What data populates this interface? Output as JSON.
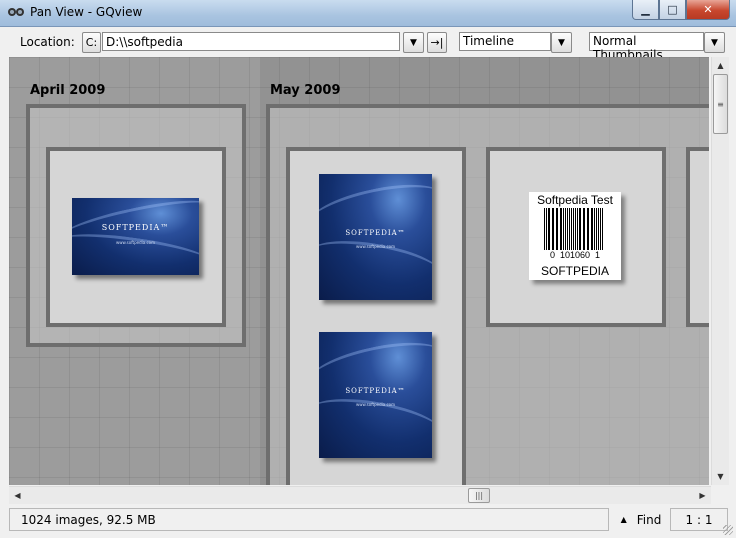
{
  "window": {
    "title": "Pan View - GQview",
    "controls": {
      "minimize": "▁",
      "maximize": "□",
      "close": "✕"
    }
  },
  "toolbar": {
    "location_label": "Location:",
    "drive_button": "C:",
    "path_value": "D:\\\\softpedia",
    "go_icon": "→|",
    "layout_select": "Timeline",
    "size_select": "Normal Thumbnails",
    "dropdown_icon": "▼"
  },
  "canvas": {
    "groups": [
      {
        "label": "April 2009"
      },
      {
        "label": "May 2009"
      }
    ],
    "thumbnails": [
      {
        "icon": "softpedia-wallpaper",
        "brand": "SOFTPEDIA™",
        "url": "www.softpedia.com"
      },
      {
        "icon": "softpedia-wallpaper",
        "brand": "SOFTPEDIA™",
        "url": "www.softpedia.com"
      },
      {
        "icon": "softpedia-wallpaper",
        "brand": "SOFTPEDIA™",
        "url": "www.softpedia.com"
      }
    ],
    "barcode": {
      "top_text": "Softpedia Test",
      "number_left": "0",
      "number_mid": "101060",
      "number_right": "1",
      "bottom_text": "SOFTPEDIA"
    }
  },
  "statusbar": {
    "info": "1024 images, 92.5 MB",
    "find_label": "Find",
    "find_icon": "▲",
    "zoom": "1 : 1"
  },
  "colors": {
    "canvas_bg": "#9c9c9c",
    "frame_border": "#6e6e6e",
    "close_button": "#c8472e"
  }
}
